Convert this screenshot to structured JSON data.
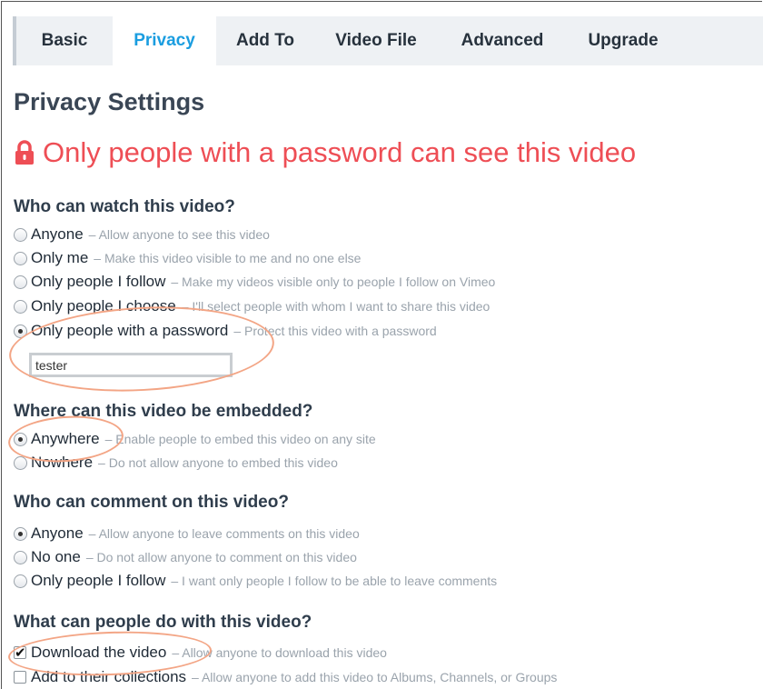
{
  "tabs": [
    {
      "label": "Basic",
      "active": false
    },
    {
      "label": "Privacy",
      "active": true
    },
    {
      "label": "Add To",
      "active": false
    },
    {
      "label": "Video File",
      "active": false
    },
    {
      "label": "Advanced",
      "active": false
    },
    {
      "label": "Upgrade",
      "active": false
    }
  ],
  "page_title": "Privacy Settings",
  "status": {
    "icon": "lock-icon",
    "text": "Only people with a password can see this video",
    "color": "#ee4e55"
  },
  "watch": {
    "heading": "Who can watch this video?",
    "options": [
      {
        "label": "Anyone",
        "desc": "– Allow anyone to see this video",
        "checked": false
      },
      {
        "label": "Only me",
        "desc": "– Make this video visible to me and no one else",
        "checked": false
      },
      {
        "label": "Only people I follow",
        "desc": "– Make my videos visible only to people I follow on Vimeo",
        "checked": false
      },
      {
        "label": "Only people I choose",
        "desc": "– I'll select people with whom I want to share this video",
        "checked": false
      },
      {
        "label": "Only people with a password",
        "desc": "– Protect this video with a password",
        "checked": true
      }
    ],
    "password_value": "tester"
  },
  "embed": {
    "heading": "Where can this video be embedded?",
    "options": [
      {
        "label": "Anywhere",
        "desc": "– Enable people to embed this video on any site",
        "checked": true
      },
      {
        "label": "Nowhere",
        "desc": "– Do not allow anyone to embed this video",
        "checked": false
      }
    ]
  },
  "comment": {
    "heading": "Who can comment on this video?",
    "options": [
      {
        "label": "Anyone",
        "desc": "– Allow anyone to leave comments on this video",
        "checked": true
      },
      {
        "label": "No one",
        "desc": "– Do not allow anyone to comment on this video",
        "checked": false
      },
      {
        "label": "Only people I follow",
        "desc": "– I want only people I follow to be able to leave comments",
        "checked": false
      }
    ]
  },
  "actions": {
    "heading": "What can people do with this video?",
    "options": [
      {
        "label": "Download the video",
        "desc": "– Allow anyone to download this video",
        "checked": true
      },
      {
        "label": "Add to their collections",
        "desc": "– Allow anyone to add this video to Albums, Channels, or Groups",
        "checked": false
      }
    ]
  },
  "colors": {
    "accent": "#1a9de0",
    "highlight": "#f3a585"
  }
}
